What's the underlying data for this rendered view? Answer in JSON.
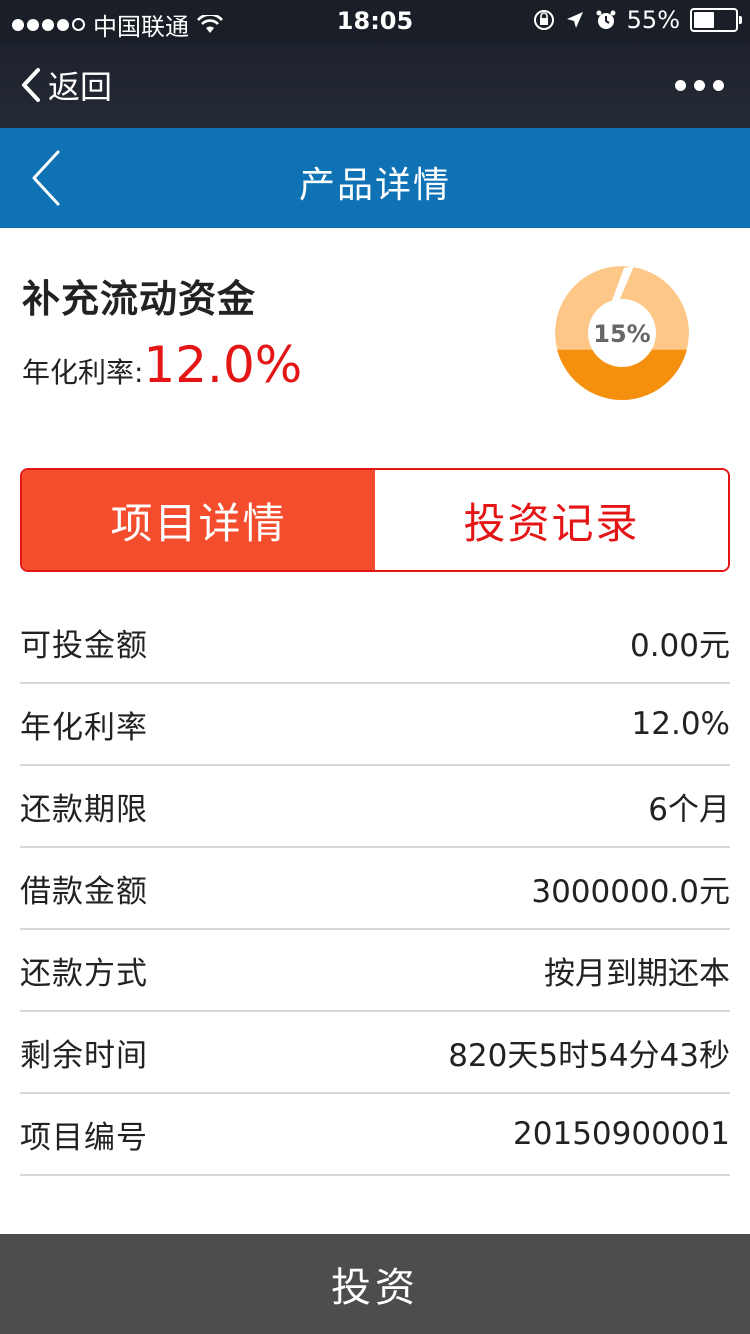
{
  "status_bar": {
    "carrier": "中国联通",
    "time": "18:05",
    "battery_percent": "55%",
    "battery_level": 0.55,
    "signal_bars": 4
  },
  "wechat_bar": {
    "back_label": "返回"
  },
  "app_bar": {
    "title": "产品详情"
  },
  "product": {
    "name": "补充流动资金",
    "rate_label": "年化利率:",
    "rate_value": "12.0%",
    "progress_text": "15%",
    "progress_fraction": 0.15
  },
  "tabs": [
    {
      "label": "项目详情",
      "active": true
    },
    {
      "label": "投资记录",
      "active": false
    }
  ],
  "details": [
    {
      "label": "可投金额",
      "value": "0.00元"
    },
    {
      "label": "年化利率",
      "value": "12.0%"
    },
    {
      "label": "还款期限",
      "value": "6个月"
    },
    {
      "label": "借款金额",
      "value": "3000000.0元"
    },
    {
      "label": "还款方式",
      "value": "按月到期还本"
    },
    {
      "label": "剩余时间",
      "value": "820天5时54分43秒"
    },
    {
      "label": "项目编号",
      "value": "20150900001"
    }
  ],
  "invest_button": {
    "label": "投资"
  },
  "colors": {
    "app_bar": "#0e72b5",
    "accent_red": "#e41515",
    "active_tab": "#f44d2e",
    "invest_bar": "#4d4d4d",
    "progress_orange": "#f5900f",
    "progress_light": "#fcc787"
  }
}
